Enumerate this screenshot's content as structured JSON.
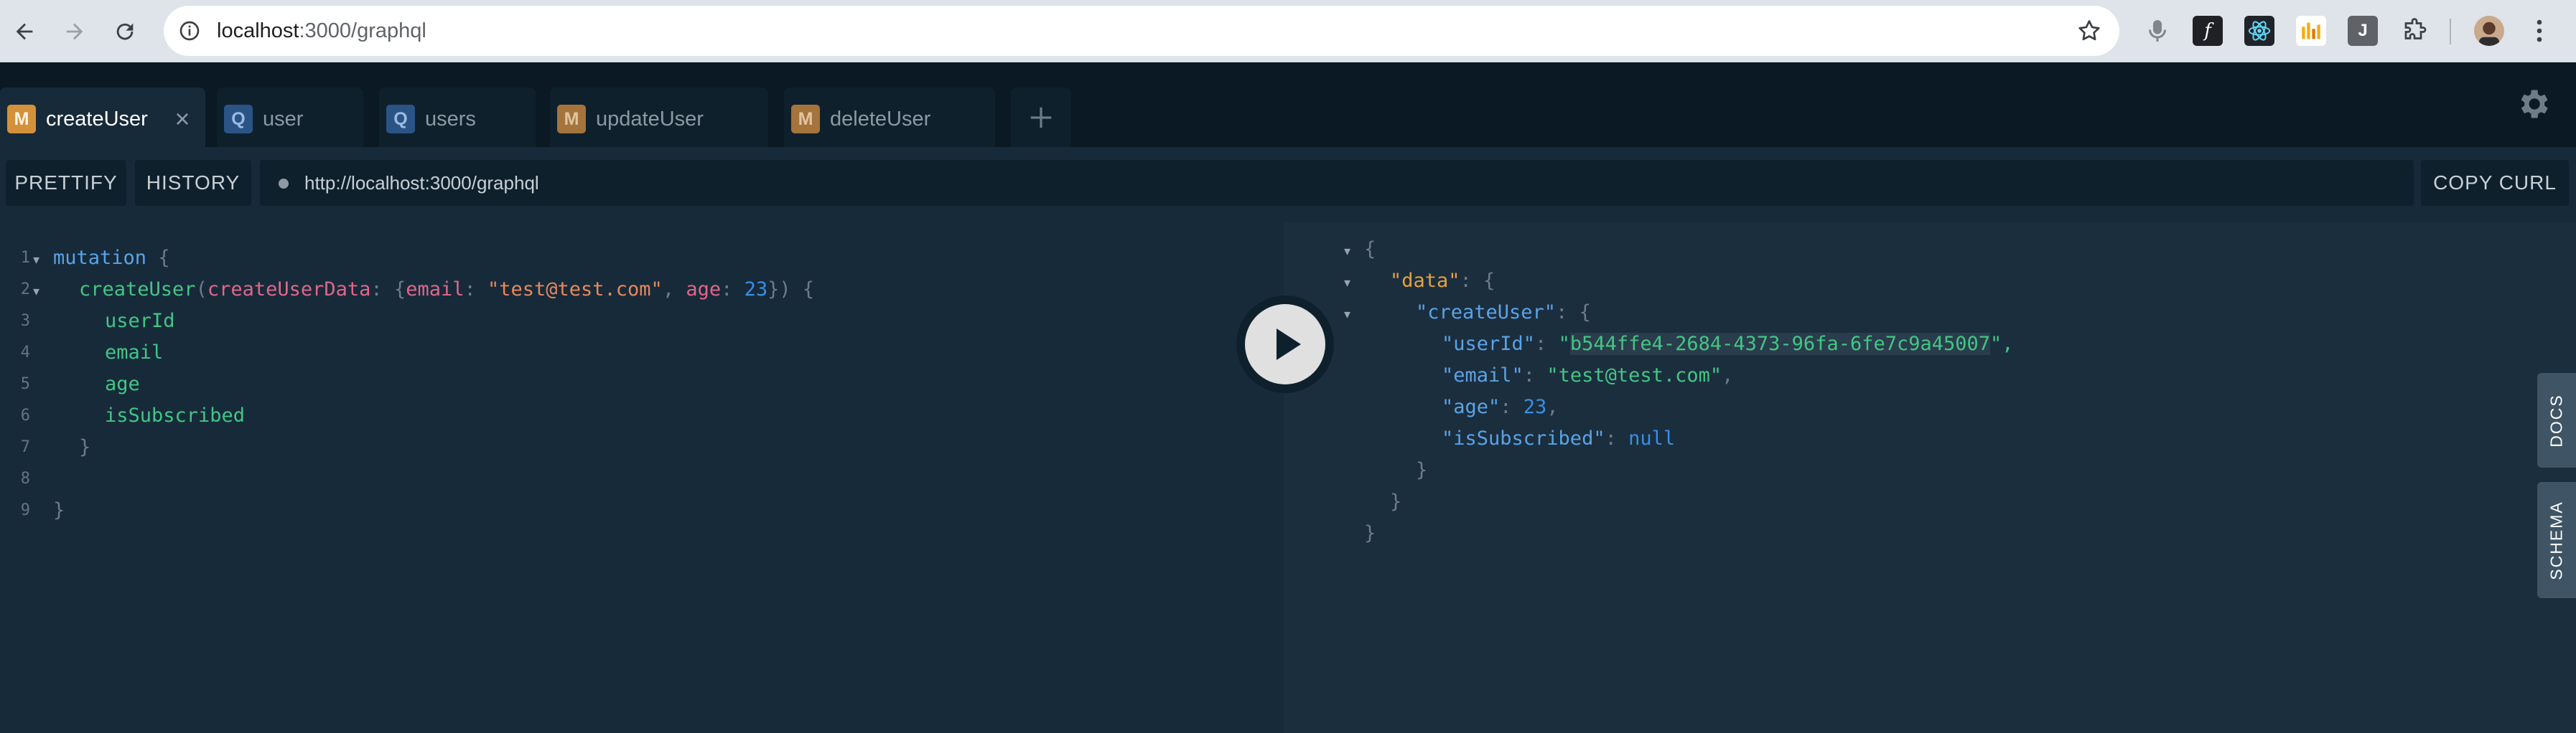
{
  "browser": {
    "url_host": "localhost",
    "url_path": ":3000/graphql",
    "extensions": [
      "microphone-icon",
      "function-icon",
      "react-icon",
      "chart-icon",
      "J",
      "puzzle-icon",
      "profile-avatar",
      "menu-icon"
    ],
    "extension_j_label": "J"
  },
  "tabs": [
    {
      "badge": "M",
      "label": "createUser",
      "active": true
    },
    {
      "badge": "Q",
      "label": "user"
    },
    {
      "badge": "Q",
      "label": "users"
    },
    {
      "badge": "M",
      "label": "updateUser"
    },
    {
      "badge": "M",
      "label": "deleteUser"
    }
  ],
  "toolbar": {
    "prettify": "PRETTIFY",
    "history": "HISTORY",
    "endpoint": "http://localhost:3000/graphql",
    "copy_curl": "COPY CURL"
  },
  "editor": {
    "line_numbers": [
      "1",
      "2",
      "3",
      "4",
      "5",
      "6",
      "7",
      "8",
      "9"
    ],
    "l1_kw": "mutation",
    "l1_brace": "{",
    "l2_fn": "createUser",
    "l2_open": "(",
    "l2_arg": "createUserData",
    "l2_colon": ": {",
    "l2_key1": "email",
    "l2_colon2": ": ",
    "l2_str": "\"test@test.com\"",
    "l2_comma": ", ",
    "l2_key2": "age",
    "l2_colon3": ": ",
    "l2_num": "23",
    "l2_close": "}) {",
    "fields": [
      "userId",
      "email",
      "age",
      "isSubscribed"
    ],
    "l7_close": "}",
    "l9_close": "}"
  },
  "result": {
    "open": "{",
    "data_key": "\"data\"",
    "data_sep": ": {",
    "create_key": "\"createUser\"",
    "create_sep": ": {",
    "userId_key": "\"userId\"",
    "userId_val_q1": "\"",
    "userId_val": "b544ffe4-2684-4373-96fa-6fe7c9a45007",
    "userId_val_q2": "\",",
    "email_key": "\"email\"",
    "email_val": "\"test@test.com\"",
    "age_key": "\"age\"",
    "age_val": "23",
    "sub_key": "\"isSubscribed\"",
    "sub_val": "null",
    "close1": "}",
    "close2": "}",
    "close3": "}",
    "colon": ": ",
    "comma": ","
  },
  "side": {
    "docs": "DOCS",
    "schema": "SCHEMA"
  },
  "colors": {
    "mutation_badge": "#a4743c",
    "query_badge": "#2a5485",
    "background": "#172a3a"
  }
}
